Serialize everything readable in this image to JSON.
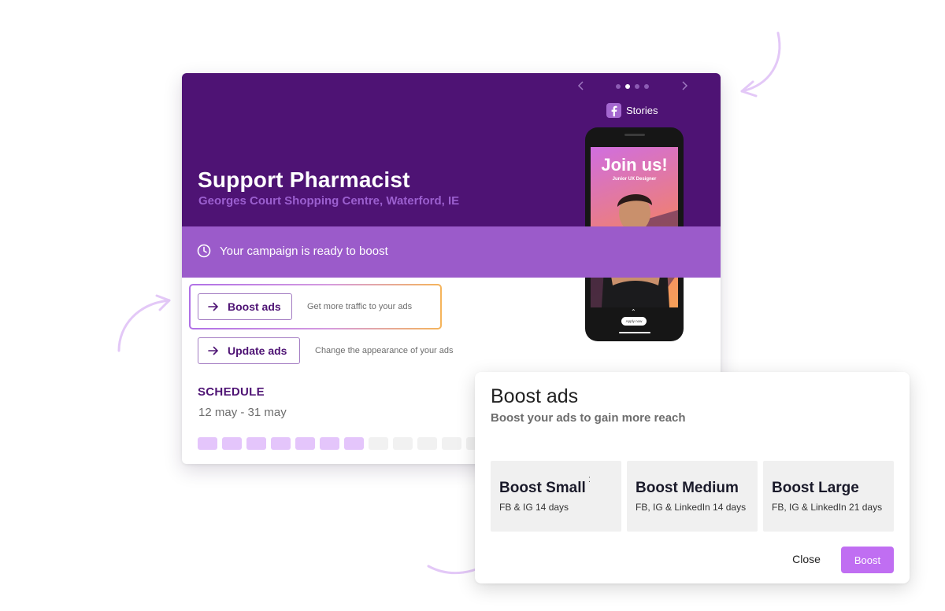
{
  "colors": {
    "brand_dark": "#4e1374",
    "brand_banner": "#9b5bca",
    "location_text": "#9b5fcf",
    "schedule_on": "#e4c5fb",
    "schedule_off": "#f1f1f1",
    "boost_button": "#c06ef2",
    "decor_arrow": "#e3c8f7"
  },
  "job": {
    "title": "Support Pharmacist",
    "location": "Georges Court Shopping Centre, Waterford, IE"
  },
  "banner": {
    "icon": "clock-icon",
    "text": "Your campaign is ready to boost"
  },
  "actions": [
    {
      "label": "Boost ads",
      "description": "Get more traffic to your ads",
      "icon": "arrow-right-icon",
      "highlighted": true
    },
    {
      "label": "Update ads",
      "description": "Change the appearance of your ads",
      "icon": "arrow-right-icon",
      "highlighted": false
    }
  ],
  "schedule": {
    "title": "SCHEDULE",
    "range": "12 may - 31 may",
    "days": [
      true,
      true,
      true,
      true,
      true,
      true,
      true,
      false,
      false,
      false,
      false,
      false
    ]
  },
  "preview": {
    "carousel_dots": 4,
    "carousel_active_index": 1,
    "platform_icon": "facebook-icon",
    "platform_label": "Stories",
    "ad_headline": "Join us!",
    "ad_subheadline": "Junior UX Designer",
    "ad_cta": "Apply now"
  },
  "dialog": {
    "title": "Boost ads",
    "subtitle": "Boost your ads to gain more reach",
    "options": [
      {
        "name": "Boost Small",
        "description": "FB & IG 14 days"
      },
      {
        "name": "Boost Medium",
        "description": "FB, IG & LinkedIn 14 days"
      },
      {
        "name": "Boost Large",
        "description": "FB, IG & LinkedIn 21 days"
      }
    ],
    "close_label": "Close",
    "boost_label": "Boost"
  }
}
